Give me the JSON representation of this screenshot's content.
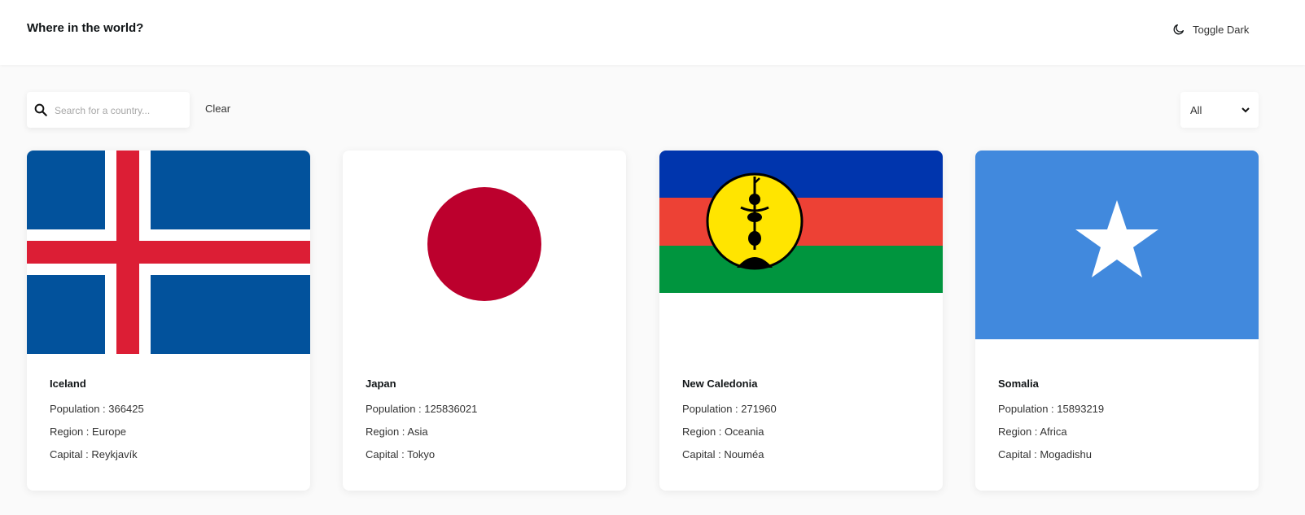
{
  "header": {
    "title": "Where in the world?",
    "toggle_label": "Toggle Dark",
    "toggle_icon": "moon-icon"
  },
  "controls": {
    "search_placeholder": "Search for a country...",
    "search_icon": "search-icon",
    "clear_label": "Clear",
    "region_selected": "All",
    "region_icon": "chevron-down-icon"
  },
  "labels": {
    "population": "Population :",
    "region": "Region :",
    "capital": "Capital :"
  },
  "countries": [
    {
      "name": "Iceland",
      "population": "366425",
      "region": "Europe",
      "capital": "Reykjavík"
    },
    {
      "name": "Japan",
      "population": "125836021",
      "region": "Asia",
      "capital": "Tokyo"
    },
    {
      "name": "New Caledonia",
      "population": "271960",
      "region": "Oceania",
      "capital": "Nouméa"
    },
    {
      "name": "Somalia",
      "population": "15893219",
      "region": "Africa",
      "capital": "Mogadishu"
    }
  ],
  "colors": {
    "background": "#fafafa",
    "surface": "#ffffff",
    "text": "#111517",
    "iceland_blue": "#02529c",
    "iceland_red": "#dc1e35",
    "japan_red": "#bc002d",
    "nc_blue": "#0035ad",
    "nc_red": "#ed4135",
    "nc_green": "#00953e",
    "nc_yellow": "#ffe500",
    "somalia_blue": "#4189dd"
  }
}
